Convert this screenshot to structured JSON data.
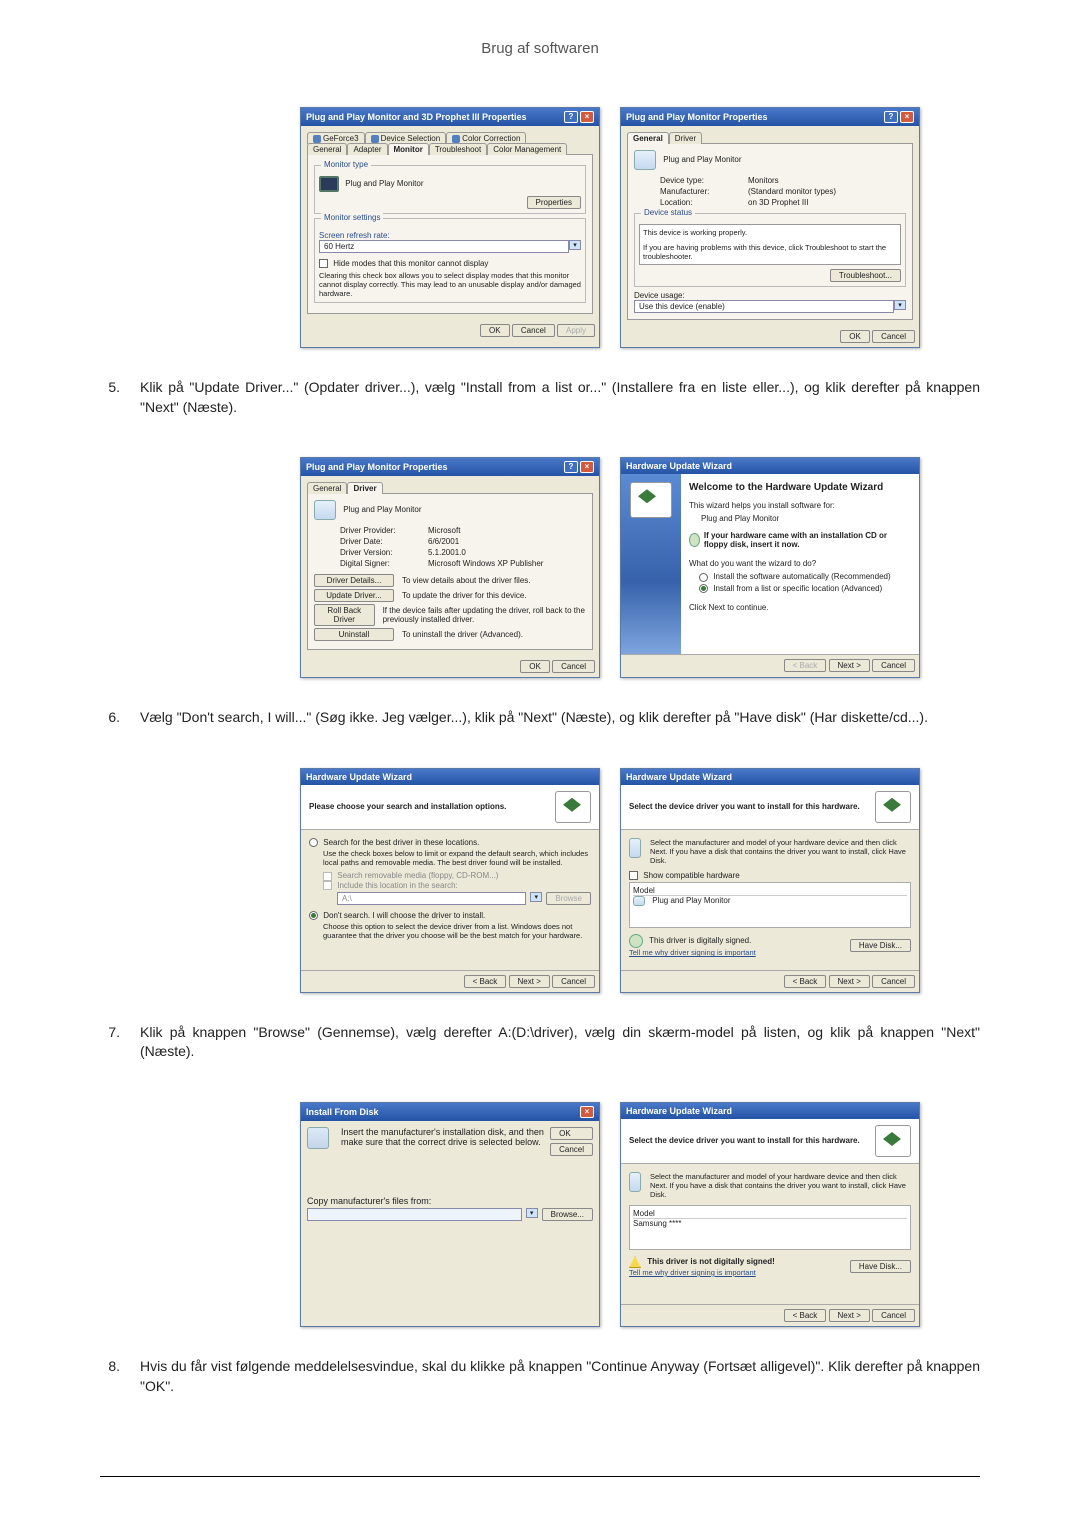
{
  "page": {
    "title": "Brug af softwaren"
  },
  "dlg1": {
    "title": "Plug and Play Monitor and 3D Prophet III Properties",
    "tabs": [
      "GeForce3",
      "Device Selection",
      "Color Correction",
      "General",
      "Adapter",
      "Monitor",
      "Troubleshoot",
      "Color Management"
    ],
    "monitor_type_label": "Monitor type",
    "monitor_type": "Plug and Play Monitor",
    "properties_btn": "Properties",
    "settings_label": "Monitor settings",
    "refresh_label": "Screen refresh rate:",
    "refresh_value": "60 Hertz",
    "hide_modes_checkbox": "Hide modes that this monitor cannot display",
    "hide_modes_desc": "Clearing this check box allows you to select display modes that this monitor cannot display correctly. This may lead to an unusable display and/or damaged hardware.",
    "ok": "OK",
    "cancel": "Cancel",
    "apply": "Apply"
  },
  "dlg2": {
    "title": "Plug and Play Monitor Properties",
    "tabs": [
      "General",
      "Driver"
    ],
    "device_name": "Plug and Play Monitor",
    "rows": {
      "device_type_label": "Device type:",
      "device_type": "Monitors",
      "manufacturer_label": "Manufacturer:",
      "manufacturer": "(Standard monitor types)",
      "location_label": "Location:",
      "location": "on 3D Prophet III"
    },
    "status_label": "Device status",
    "status_text": "This device is working properly.",
    "status_help": "If you are having problems with this device, click Troubleshoot to start the troubleshooter.",
    "troubleshoot": "Troubleshoot...",
    "usage_label": "Device usage:",
    "usage_value": "Use this device (enable)",
    "ok": "OK",
    "cancel": "Cancel"
  },
  "step5": {
    "num": "5.",
    "text": "Klik på \"Update Driver...\" (Opdater driver...), vælg \"Install from a list or...\" (Installere fra en liste eller...), og klik derefter på knappen \"Next\" (Næste)."
  },
  "dlg3": {
    "title": "Plug and Play Monitor Properties",
    "tabs": [
      "General",
      "Driver"
    ],
    "device_name": "Plug and Play Monitor",
    "rows": {
      "provider_label": "Driver Provider:",
      "provider": "Microsoft",
      "date_label": "Driver Date:",
      "date": "6/6/2001",
      "version_label": "Driver Version:",
      "version": "5.1.2001.0",
      "signer_label": "Digital Signer:",
      "signer": "Microsoft Windows XP Publisher"
    },
    "buttons": {
      "details": "Driver Details...",
      "details_desc": "To view details about the driver files.",
      "update": "Update Driver...",
      "update_desc": "To update the driver for this device.",
      "rollback": "Roll Back Driver",
      "rollback_desc": "If the device fails after updating the driver, roll back to the previously installed driver.",
      "uninstall": "Uninstall",
      "uninstall_desc": "To uninstall the driver (Advanced)."
    },
    "ok": "OK",
    "cancel": "Cancel"
  },
  "dlg4": {
    "title": "Hardware Update Wizard",
    "heading": "Welcome to the Hardware Update Wizard",
    "line1": "This wizard helps you install software for:",
    "device": "Plug and Play Monitor",
    "hint": "If your hardware came with an installation CD or floppy disk, insert it now.",
    "question": "What do you want the wizard to do?",
    "opt1": "Install the software automatically (Recommended)",
    "opt2": "Install from a list or specific location (Advanced)",
    "continue": "Click Next to continue.",
    "back": "< Back",
    "next": "Next >",
    "cancel": "Cancel"
  },
  "step6": {
    "num": "6.",
    "text": "Vælg \"Don't search, I will...\" (Søg ikke. Jeg vælger...), klik på \"Next\" (Næste), og klik derefter på \"Have disk\" (Har diskette/cd...)."
  },
  "dlg5": {
    "title": "Hardware Update Wizard",
    "header": "Please choose your search and installation options.",
    "opt1_label": "Search for the best driver in these locations.",
    "opt1_desc": "Use the check boxes below to limit or expand the default search, which includes local paths and removable media. The best driver found will be installed.",
    "chk1": "Search removable media (floppy, CD-ROM...)",
    "chk2": "Include this location in the search:",
    "path": "A:\\",
    "browse": "Browse",
    "opt2_label": "Don't search. I will choose the driver to install.",
    "opt2_desc": "Choose this option to select the device driver from a list. Windows does not guarantee that the driver you choose will be the best match for your hardware.",
    "back": "< Back",
    "next": "Next >",
    "cancel": "Cancel"
  },
  "dlg6": {
    "title": "Hardware Update Wizard",
    "header": "Select the device driver you want to install for this hardware.",
    "instruction": "Select the manufacturer and model of your hardware device and then click Next. If you have a disk that contains the driver you want to install, click Have Disk.",
    "show_compatible": "Show compatible hardware",
    "model_label": "Model",
    "model_item": "Plug and Play Monitor",
    "sign_ok": "This driver is digitally signed.",
    "sign_link": "Tell me why driver signing is important",
    "have_disk": "Have Disk...",
    "back": "< Back",
    "next": "Next >",
    "cancel": "Cancel"
  },
  "step7": {
    "num": "7.",
    "text": "Klik på knappen \"Browse\" (Gennemse), vælg derefter A:(D:\\driver), vælg din skærm-model på listen, og klik på knappen \"Next\" (Næste)."
  },
  "dlg7": {
    "title": "Install From Disk",
    "text": "Insert the manufacturer's installation disk, and then make sure that the correct drive is selected below.",
    "ok": "OK",
    "cancel": "Cancel",
    "copy_label": "Copy manufacturer's files from:",
    "path": "",
    "browse": "Browse..."
  },
  "dlg8": {
    "title": "Hardware Update Wizard",
    "header": "Select the device driver you want to install for this hardware.",
    "instruction": "Select the manufacturer and model of your hardware device and then click Next. If you have a disk that contains the driver you want to install, click Have Disk.",
    "model_label": "Model",
    "model_item": "Samsung ****",
    "warn": "This driver is not digitally signed!",
    "sign_link": "Tell me why driver signing is important",
    "have_disk": "Have Disk...",
    "back": "< Back",
    "next": "Next >",
    "cancel": "Cancel"
  },
  "step8": {
    "num": "8.",
    "text": "Hvis du får vist følgende meddelelsesvindue, skal du klikke på knappen \"Continue Anyway (Fortsæt alligevel)\". Klik derefter på knappen \"OK\"."
  }
}
